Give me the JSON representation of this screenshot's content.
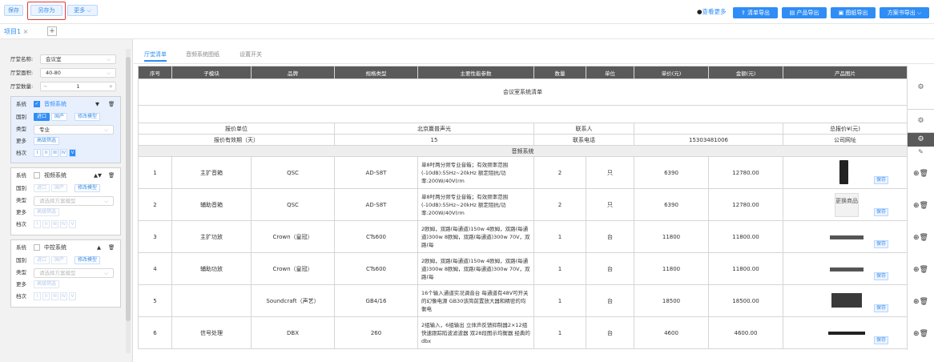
{
  "toolbar": {
    "save": "保存",
    "save_as": "另存为",
    "more": "更多",
    "view_more": "查看更多",
    "export_list": "清单导出",
    "export_product": "产品导出",
    "export_drawing": "图纸导出",
    "export_plan": "方案书导出"
  },
  "tabs": {
    "project": "项目1"
  },
  "left": {
    "hall_name_label": "厅堂名称:",
    "hall_name": "会议室",
    "hall_area_label": "厅堂面积:",
    "hall_area": "40-80",
    "hall_count_label": "厅堂数量:",
    "hall_count": "1",
    "systems": [
      {
        "label": "系统",
        "name": "音频系统",
        "origin_label": "国别",
        "import": "进口",
        "domestic": "国产",
        "modify": "修改模型",
        "type_label": "类型",
        "type_value": "专业",
        "more_label": "更多",
        "advanced": "高级筛选",
        "level_label": "档次",
        "levels": [
          "I",
          "II",
          "III",
          "IV",
          "V"
        ],
        "arrows": "▼",
        "checked": true
      },
      {
        "label": "系统",
        "name": "视频系统",
        "origin_label": "国别",
        "import": "进口",
        "domestic": "国产",
        "modify": "修改模型",
        "type_label": "类型",
        "type_value": "请选择方案模型",
        "more_label": "更多",
        "advanced": "高级筛选",
        "level_label": "档次",
        "levels": [
          "I",
          "II",
          "III",
          "IV",
          "V"
        ],
        "arrows": "▲▼",
        "checked": false
      },
      {
        "label": "系统",
        "name": "中控系统",
        "origin_label": "国别",
        "import": "进口",
        "domestic": "国产",
        "modify": "修改模型",
        "type_label": "类型",
        "type_value": "请选择方案模型",
        "more_label": "更多",
        "advanced": "高级筛选",
        "level_label": "档次",
        "levels": [
          "I",
          "II",
          "III",
          "IV",
          "V"
        ],
        "arrows": "▲",
        "checked": false
      }
    ]
  },
  "main": {
    "tabs": [
      "厅堂清单",
      "音频系统图纸",
      "设置开关"
    ],
    "sheet_title": "会议室系统清单",
    "info": {
      "quote_unit_label": "报价单位",
      "quote_unit": "北京赢普声光",
      "contact_label": "联系人",
      "total_label": "总报价¥(元)",
      "valid_label": "报价有效期（天）",
      "valid": "15",
      "phone_label": "联系电话",
      "phone": "15303481006",
      "site_label": "公司网址"
    },
    "headers": [
      "序号",
      "子模块",
      "品牌",
      "规格类型",
      "主要性能参数",
      "数量",
      "单位",
      "单价(元)",
      "金额(元)",
      "产品图片"
    ],
    "section": "音频系统",
    "save_tag": "保存",
    "rows": [
      {
        "no": "1",
        "module": "主扩音箱",
        "brand": "QSC",
        "model": "AD-S8T",
        "desc": "单8吋两分频专业音箱；有效频率范围(-10dB):55Hz~20kHz 额定阻抗/功率:200W/40V(rm",
        "qty": "2",
        "unit": "只",
        "price": "6390",
        "amount": "12780.00"
      },
      {
        "no": "2",
        "module": "辅助音箱",
        "brand": "QSC",
        "model": "AD-S8T",
        "desc": "单8吋两分频专业音箱；有效频率范围(-10dB):55Hz~20kHz 额定阻抗/功率:200W/40V(rm",
        "qty": "2",
        "unit": "只",
        "price": "6390",
        "amount": "12780.00",
        "img_text": "更换商品"
      },
      {
        "no": "3",
        "module": "主扩功放",
        "brand": "Crown（皇冠）",
        "model": "CTs600",
        "desc": "2欧姆，双路(每通道)150w 4欧姆，双路(每通道)300w 8欧姆，双路(每通道)300w 70V，双路(每",
        "qty": "1",
        "unit": "台",
        "price": "11800",
        "amount": "11800.00"
      },
      {
        "no": "4",
        "module": "辅助功放",
        "brand": "Crown（皇冠）",
        "model": "CTs600",
        "desc": "2欧姆，双路(每通道)150w 4欧姆，双路(每通道)300w 8欧姆，双路(每通道)300w 70V，双路(每",
        "qty": "1",
        "unit": "台",
        "price": "11800",
        "amount": "11800.00"
      },
      {
        "no": "5",
        "module": "",
        "brand": "Soundcraft（声艺）",
        "model": "GB4/16",
        "desc": "16个输入通道实况调音台 每通道有48V可开关的幻像电源 GB30该简前置放大器和精密的均衡电",
        "qty": "1",
        "unit": "台",
        "price": "18500",
        "amount": "18500.00"
      },
      {
        "no": "6",
        "module": "信号处理",
        "brand": "DBX",
        "model": "260",
        "desc": "2组输入，6组输出 立体声反馈抑制器2×12组快速跟踪陷波滤波器 双28段图示均衡器 经典的dbx",
        "qty": "1",
        "unit": "台",
        "price": "4600",
        "amount": "4600.00"
      }
    ]
  }
}
